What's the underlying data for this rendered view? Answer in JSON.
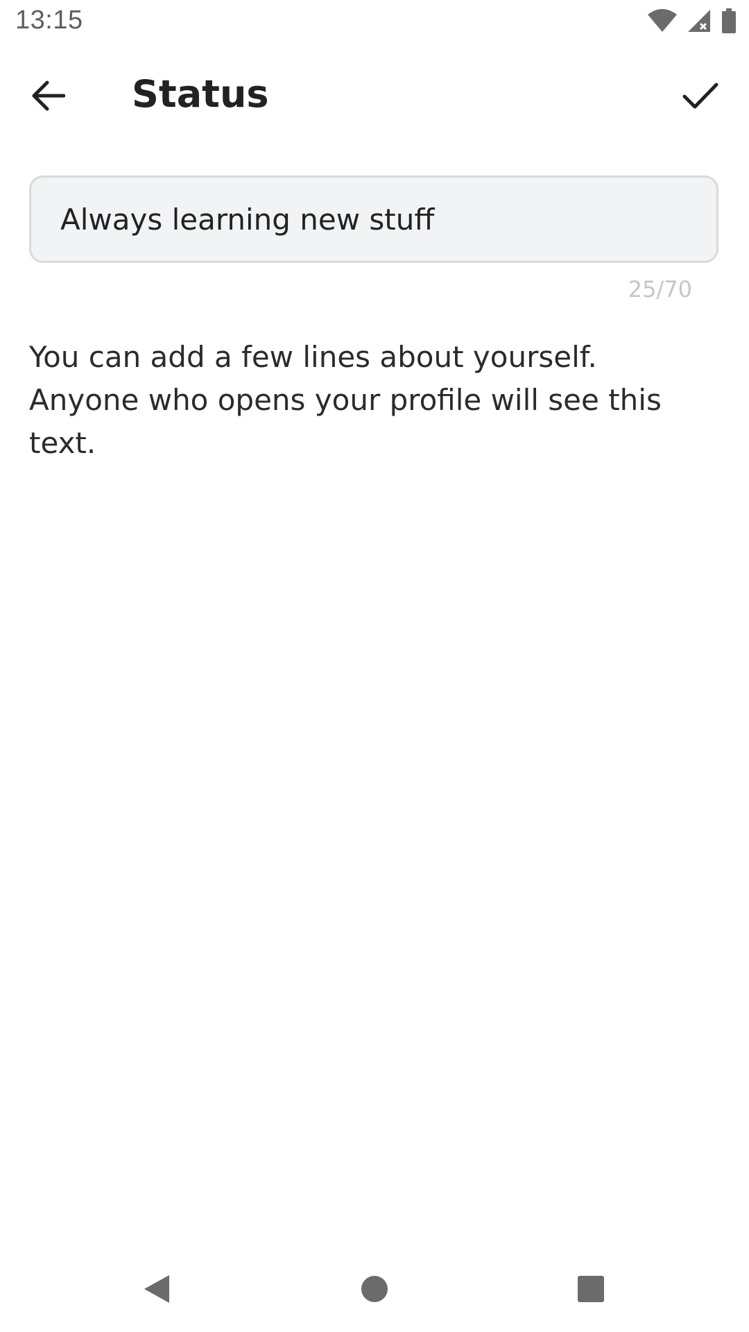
{
  "status_bar": {
    "time": "13:15",
    "icons": [
      "wifi-icon",
      "cellular-signal-icon",
      "battery-icon"
    ]
  },
  "app_bar": {
    "back_icon": "arrow-left-icon",
    "title": "Status",
    "confirm_icon": "check-icon"
  },
  "status_field": {
    "value": "Always learning new stuff",
    "counter": "25/70"
  },
  "helper": {
    "text": "You can add a few lines about yourself. Anyone who opens your profile will see this text."
  },
  "nav_bar": {
    "icons": [
      "nav-back-icon",
      "nav-home-icon",
      "nav-recents-icon"
    ]
  },
  "colors": {
    "field_background": "#f2f3f5",
    "field_border": "#d9dadc",
    "counter_text": "#c5c6c8",
    "primary_text": "#222222"
  }
}
